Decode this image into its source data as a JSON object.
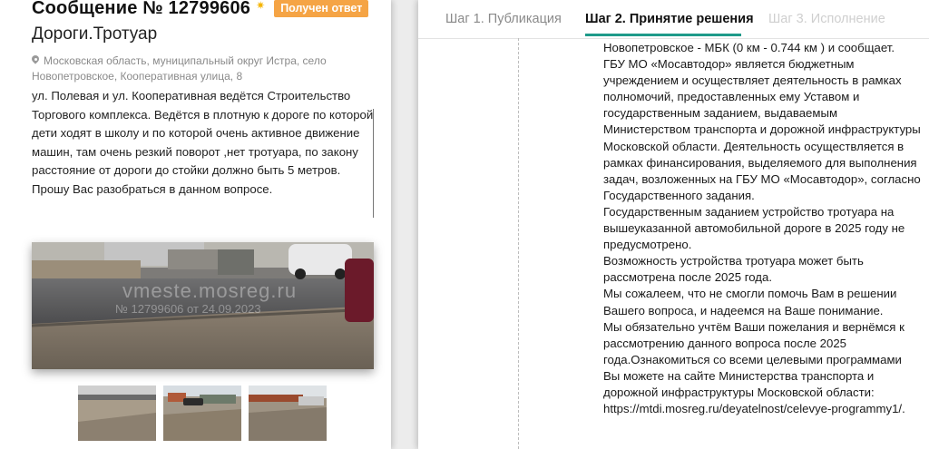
{
  "message": {
    "title": "Сообщение № 12799606",
    "status_badge": "Получен ответ",
    "category": "Дороги.Тротуар",
    "address": "Московская область, муниципальный округ Истра, село Новопетровское, Кооперативная улица, 8",
    "text": "ул. Полевая и ул. Кооперативная ведётся Строительство Торгового комплекса. Ведётся в плотную к дороге по которой дети ходят в школу и по которой очень активное движение машин, там очень резкий поворот ,нет тротуара, по закону расстояние от дороги до стойки должно быть 5 метров. Прошу Вас разобраться в данном вопросе.",
    "photo_watermark": "vmeste.mosreg.ru",
    "photo_stamp": "№ 12799606 от 24.09.2023"
  },
  "steps": [
    {
      "label": "Шаг 1. Публикация",
      "state": "done"
    },
    {
      "label": "Шаг 2. Принятие решения",
      "state": "active"
    },
    {
      "label": "Шаг 3. Исполнение",
      "state": "pending"
    }
  ],
  "answer": {
    "text": "Новопетровское - МБК (0 км - 0.744 км ) и сообщает.\nГБУ МО «Мосавтодор» является бюджетным учреждением и осуществляет деятельность в рамках полномочий, предоставленных ему Уставом и государственным заданием, выдаваемым Министерством транспорта и дорожной инфраструктуры Московской области. Деятельность осуществляется в рамках финансирования, выделяемого для выполнения задач, возложенных на ГБУ МО «Мосавтодор», согласно Государственного задания.\nГосударственным заданием устройство тротуара на вышеуказанной автомобильной дороге в 2025 году не предусмотрено.\nВозможность устройства тротуара может быть рассмотрена после 2025 года.\nМы сожалеем, что не смогли помочь Вам в решении Вашего вопроса, и надеемся на Ваше понимание.\nМы обязательно учтём Ваши пожелания и вернёмся к рассмотрению данного вопроса после 2025 года.Ознакомиться со всеми целевыми программами Вы можете на сайте Министерства транспорта и дорожной инфраструктуры Московской области: https://mtdi.mosreg.ru/deyatelnost/celevye-programmy1/."
  },
  "colors": {
    "badge": "#f5a445",
    "active_step": "#1e9a8a",
    "sun_icon": "#f5b400"
  },
  "icons": {
    "status": "sun-icon",
    "address": "location-pin-icon"
  }
}
